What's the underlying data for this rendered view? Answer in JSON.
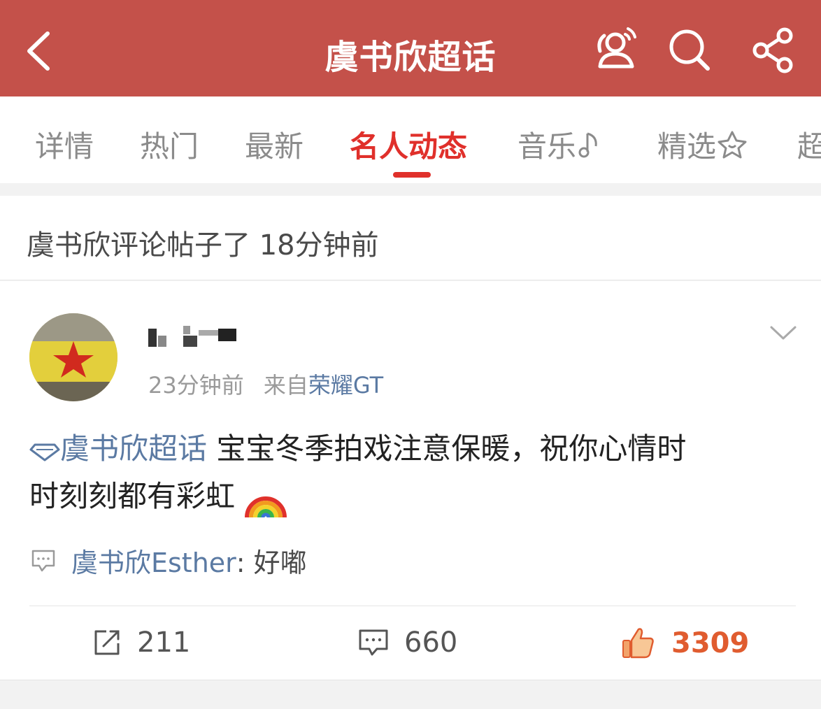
{
  "header": {
    "title": "虞书欣超话"
  },
  "tabs": [
    {
      "label": "详情"
    },
    {
      "label": "热门"
    },
    {
      "label": "最新"
    },
    {
      "label": "名人动态"
    },
    {
      "label": "音乐"
    },
    {
      "label": "精选"
    },
    {
      "label": "超"
    }
  ],
  "active_tab": "名人动态",
  "activity": {
    "text": "虞书欣评论帖子了 18分钟前"
  },
  "post": {
    "time": "23分钟前",
    "source_prefix": "来自",
    "device": "荣耀GT",
    "topic": "虞书欣超话",
    "text_line1": "宝宝冬季拍戏注意保暖，祝你心情时",
    "text_line2": "时刻刻都有彩虹",
    "comment": {
      "name": "虞书欣Esther",
      "text": ": 好嘟"
    },
    "repost_count": "211",
    "comment_count": "660",
    "like_count": "3309"
  },
  "colors": {
    "header": "#c4514a",
    "active_tab": "#e0302b",
    "link": "#5b7aa3",
    "like": "#e05c2f"
  }
}
